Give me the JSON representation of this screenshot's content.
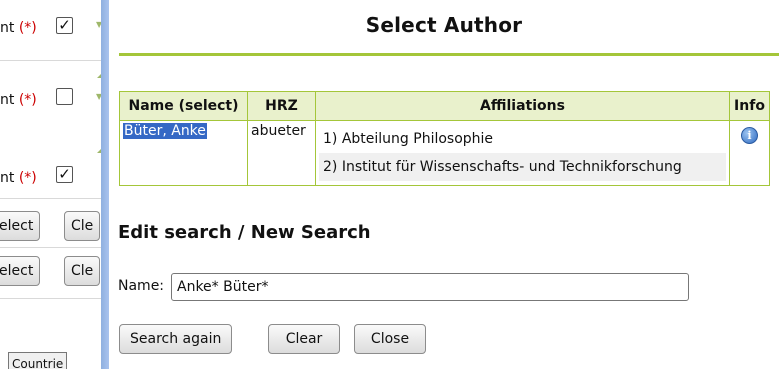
{
  "background": {
    "required_label": "nt",
    "required_star": "(*)",
    "checkbox_1": "✓",
    "checkbox_3": "✓",
    "select_label": "elect",
    "clear_label": "Cle",
    "country_label": "Countrie"
  },
  "dialog": {
    "title": "Select Author",
    "table": {
      "headers": [
        "Name (select)",
        "HRZ",
        "Affiliations",
        "Info"
      ],
      "row": {
        "name": "Büter, Anke",
        "hrz": "abueter",
        "affiliations": [
          "1) Abteilung Philosophie",
          "2) Institut für Wissenschafts- und Technikforschung"
        ],
        "info_icon": "info-icon"
      }
    },
    "edit_section": {
      "title": "Edit search / New Search",
      "name_label": "Name:",
      "name_value": "Anke* Büter*"
    },
    "buttons": {
      "search_again": "Search again",
      "clear": "Clear",
      "close": "Close"
    }
  }
}
